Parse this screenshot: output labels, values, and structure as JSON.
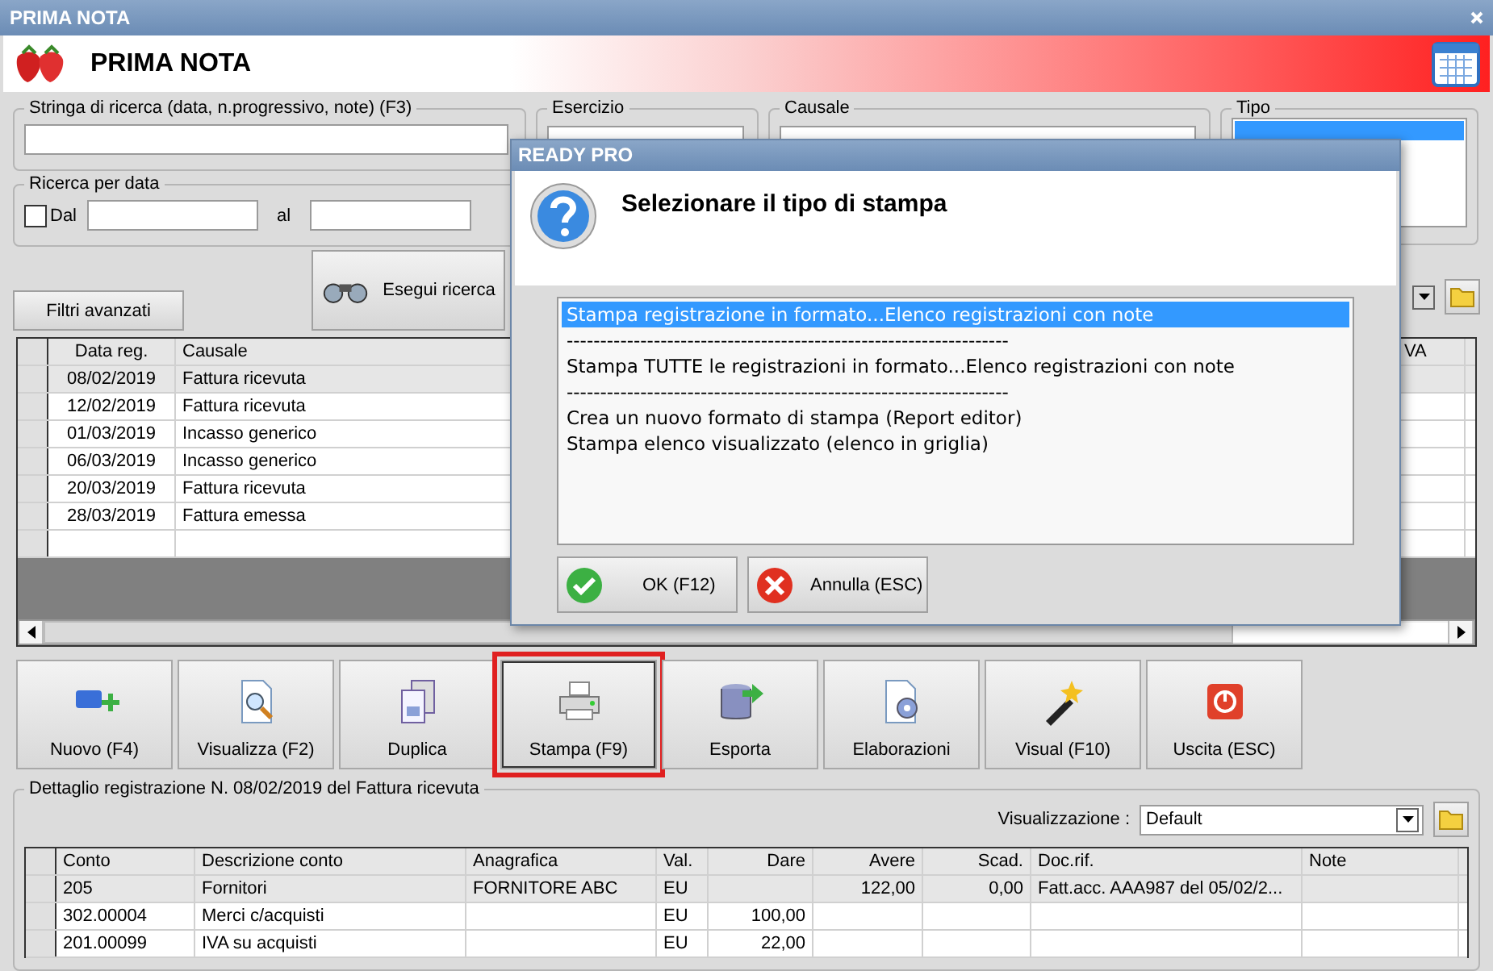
{
  "window": {
    "title": "PRIMA NOTA"
  },
  "header": {
    "title": "PRIMA NOTA"
  },
  "filters": {
    "search": {
      "label": "Stringa di ricerca (data, n.progressivo, note) (F3)"
    },
    "esercizio": {
      "label": "Esercizio"
    },
    "causale": {
      "label": "Causale"
    },
    "tipo": {
      "label": "Tipo"
    },
    "date": {
      "label": "Ricerca per data",
      "checkbox": {
        "label": "Dal",
        "checked": false
      },
      "to_label": "al"
    },
    "advanced_button": "Filtri avanzati",
    "search_button": "Esegui ricerca"
  },
  "grid": {
    "columns": [
      "Data reg.",
      "Causale",
      "VA"
    ],
    "rows": [
      {
        "date": "08/02/2019",
        "causale": "Fattura ricevuta",
        "selected": true
      },
      {
        "date": "12/02/2019",
        "causale": "Fattura ricevuta",
        "selected": false
      },
      {
        "date": "01/03/2019",
        "causale": "Incasso generico",
        "selected": false
      },
      {
        "date": "06/03/2019",
        "causale": "Incasso generico",
        "selected": false
      },
      {
        "date": "20/03/2019",
        "causale": "Fattura ricevuta",
        "selected": false
      },
      {
        "date": "28/03/2019",
        "causale": "Fattura emessa",
        "selected": false
      }
    ]
  },
  "toolbar": [
    {
      "kind": "new",
      "label": "Nuovo (F4)",
      "highlighted": false
    },
    {
      "kind": "view",
      "label": "Visualizza (F2)",
      "highlighted": false
    },
    {
      "kind": "duplicate",
      "label": "Duplica",
      "highlighted": false
    },
    {
      "kind": "print",
      "label": "Stampa (F9)",
      "highlighted": true
    },
    {
      "kind": "export",
      "label": "Esporta",
      "highlighted": false
    },
    {
      "kind": "process",
      "label": "Elaborazioni",
      "highlighted": false
    },
    {
      "kind": "visual",
      "label": "Visual (F10)",
      "highlighted": false
    },
    {
      "kind": "exit",
      "label": "Uscita (ESC)",
      "highlighted": false
    }
  ],
  "detail": {
    "title": "Dettaglio registrazione N. 08/02/2019 del Fattura ricevuta",
    "view_label": "Visualizzazione :",
    "view_value": "Default",
    "columns": [
      {
        "label": "Conto",
        "numeric": false
      },
      {
        "label": "Descrizione conto",
        "numeric": false
      },
      {
        "label": "Anagrafica",
        "numeric": false
      },
      {
        "label": "Val.",
        "numeric": false
      },
      {
        "label": "Dare",
        "numeric": true
      },
      {
        "label": "Avere",
        "numeric": true
      },
      {
        "label": "Scad.",
        "numeric": true
      },
      {
        "label": "Doc.rif.",
        "numeric": false
      },
      {
        "label": "Note",
        "numeric": false
      }
    ],
    "rows": [
      {
        "selected": true,
        "cells": [
          "205",
          "Fornitori",
          "FORNITORE ABC",
          "EU",
          "",
          "122,00",
          "0,00",
          "Fatt.acc. AAA987 del 05/02/2...",
          ""
        ]
      },
      {
        "selected": false,
        "cells": [
          "302.00004",
          "Merci c/acquisti",
          "",
          "EU",
          "100,00",
          "",
          "",
          "",
          ""
        ]
      },
      {
        "selected": false,
        "cells": [
          "201.00099",
          "IVA su acquisti",
          "",
          "EU",
          "22,00",
          "",
          "",
          "",
          ""
        ]
      }
    ]
  },
  "dialog": {
    "title": "READY PRO",
    "heading": "Selezionare il tipo di stampa",
    "options": [
      {
        "kind": "option",
        "text": "Stampa registrazione in formato...Elenco registrazioni con note",
        "selected": true
      },
      {
        "kind": "separator",
        "text": "------------------------------------------------------------------"
      },
      {
        "kind": "option",
        "text": "Stampa TUTTE le registrazioni in formato...Elenco registrazioni con note",
        "selected": false
      },
      {
        "kind": "separator",
        "text": "------------------------------------------------------------------"
      },
      {
        "kind": "option",
        "text": "Crea un nuovo formato di stampa (Report editor)",
        "selected": false
      },
      {
        "kind": "option",
        "text": "Stampa elenco visualizzato (elenco in griglia)",
        "selected": false
      }
    ],
    "buttons": [
      {
        "kind": "ok",
        "label": "OK (F12)"
      },
      {
        "kind": "cancel",
        "label": "Annulla (ESC)"
      }
    ]
  }
}
